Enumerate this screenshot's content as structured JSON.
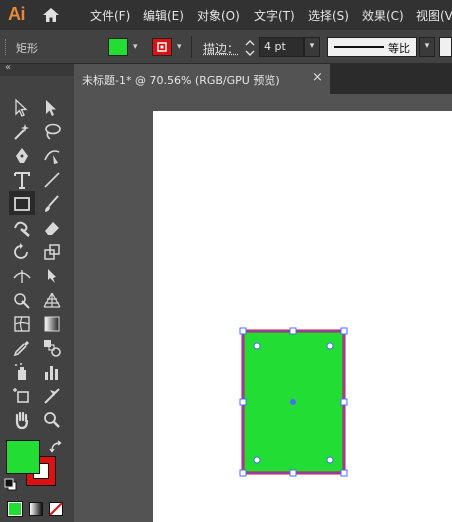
{
  "app": {
    "logo": "Ai"
  },
  "menu": {
    "items": [
      "文件(F)",
      "编辑(E)",
      "对象(O)",
      "文字(T)",
      "选择(S)",
      "效果(C)",
      "视图(V"
    ]
  },
  "control_bar": {
    "selection_name": "矩形",
    "fill_color": "#22dd33",
    "stroke_color": "#dd1111",
    "stroke_label": "描边：",
    "stroke_weight": "4 pt",
    "stroke_profile": "等比"
  },
  "document": {
    "tab_title": "未标题-1* @ 70.56% (RGB/GPU 预览)",
    "close": "×"
  },
  "toolbar": {
    "fill_swatch_color": "#22dd33",
    "stroke_swatch_color": "#dd1111",
    "tools": [
      [
        "selection-tool-icon",
        "direct-selection-tool-icon"
      ],
      [
        "magic-wand-tool-icon",
        "lasso-tool-icon"
      ],
      [
        "pen-tool-icon",
        "curvature-tool-icon"
      ],
      [
        "type-tool-icon",
        "line-segment-tool-icon"
      ],
      [
        "rectangle-tool-icon",
        "paintbrush-tool-icon"
      ],
      [
        "shaper-tool-icon",
        "eraser-tool-icon"
      ],
      [
        "rotate-tool-icon",
        "scale-tool-icon"
      ],
      [
        "width-tool-icon",
        "puppet-warp-tool-icon"
      ],
      [
        "shape-builder-tool-icon",
        "perspective-grid-tool-icon"
      ],
      [
        "mesh-tool-icon",
        "gradient-tool-icon"
      ],
      [
        "eyedropper-tool-icon",
        "blend-tool-icon"
      ],
      [
        "symbol-sprayer-tool-icon",
        "column-graph-tool-icon"
      ],
      [
        "artboard-tool-icon",
        "slice-tool-icon"
      ],
      [
        "hand-tool-icon",
        "zoom-tool-icon"
      ]
    ]
  },
  "artwork": {
    "fill": "#22dd33",
    "stroke": "#dd1144"
  }
}
